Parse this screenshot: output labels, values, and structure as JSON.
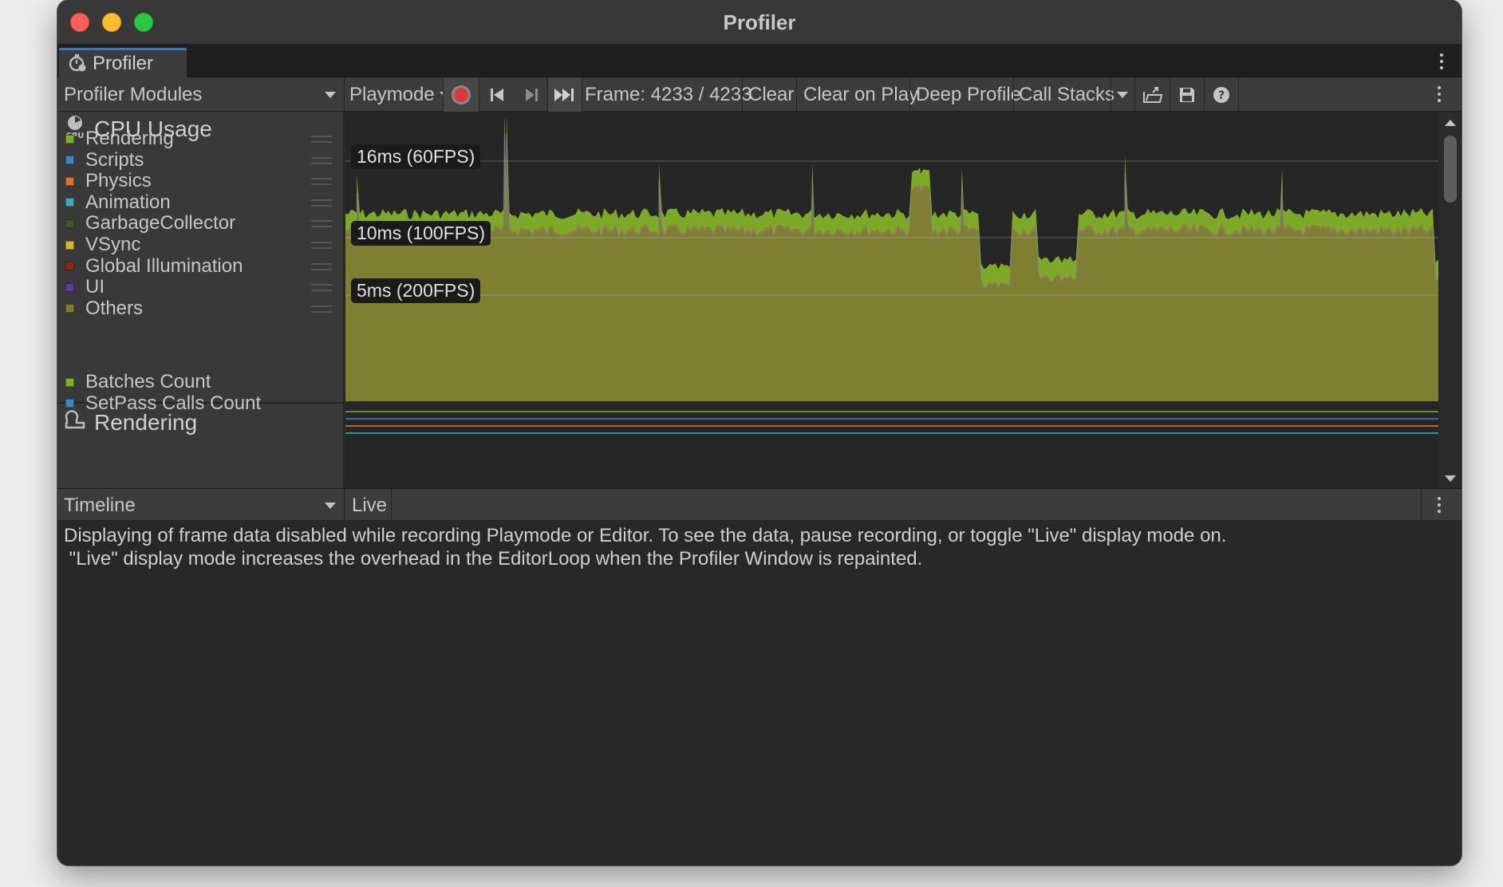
{
  "window": {
    "title": "Profiler"
  },
  "tab": {
    "label": "Profiler",
    "icon": "stopwatch-icon"
  },
  "toolbar": {
    "modules_dropdown": "Profiler Modules",
    "target_dropdown": "Playmode",
    "frame_label": "Frame: 4233 / 4233",
    "clear": "Clear",
    "clear_on_play": "Clear on Play",
    "deep_profile": "Deep Profile",
    "call_stacks": "Call Stacks"
  },
  "cpu_module": {
    "title": "CPU Usage",
    "icon_label": "CPU",
    "legend": [
      {
        "label": "Rendering",
        "color": "#7cb028"
      },
      {
        "label": "Scripts",
        "color": "#3d87c0"
      },
      {
        "label": "Physics",
        "color": "#d9722a"
      },
      {
        "label": "Animation",
        "color": "#3fa8b8"
      },
      {
        "label": "GarbageCollector",
        "color": "#3c5a23"
      },
      {
        "label": "VSync",
        "color": "#d5b52a"
      },
      {
        "label": "Global Illumination",
        "color": "#8a2a1a"
      },
      {
        "label": "UI",
        "color": "#5a3c9c"
      },
      {
        "label": "Others",
        "color": "#7f7f32"
      }
    ],
    "fps_markers": [
      "16ms (60FPS)",
      "10ms (100FPS)",
      "5ms (200FPS)"
    ]
  },
  "rendering_module": {
    "title": "Rendering",
    "legend": [
      {
        "label": "Batches Count",
        "color": "#7cb028"
      },
      {
        "label": "SetPass Calls Count",
        "color": "#3d87c0"
      }
    ]
  },
  "details": {
    "view_dropdown": "Timeline",
    "live_button": "Live",
    "message_line1": "Displaying of frame data disabled while recording Playmode or Editor. To see the data, pause recording, or toggle \"Live\" display mode on.",
    "message_line2": " \"Live\" display mode increases the overhead in the EditorLoop when the Profiler Window is repainted."
  },
  "colors": {
    "others_fill": "#7f7f32",
    "rendering_fill": "#7cb028",
    "accent_tab": "#3a79bb"
  }
}
